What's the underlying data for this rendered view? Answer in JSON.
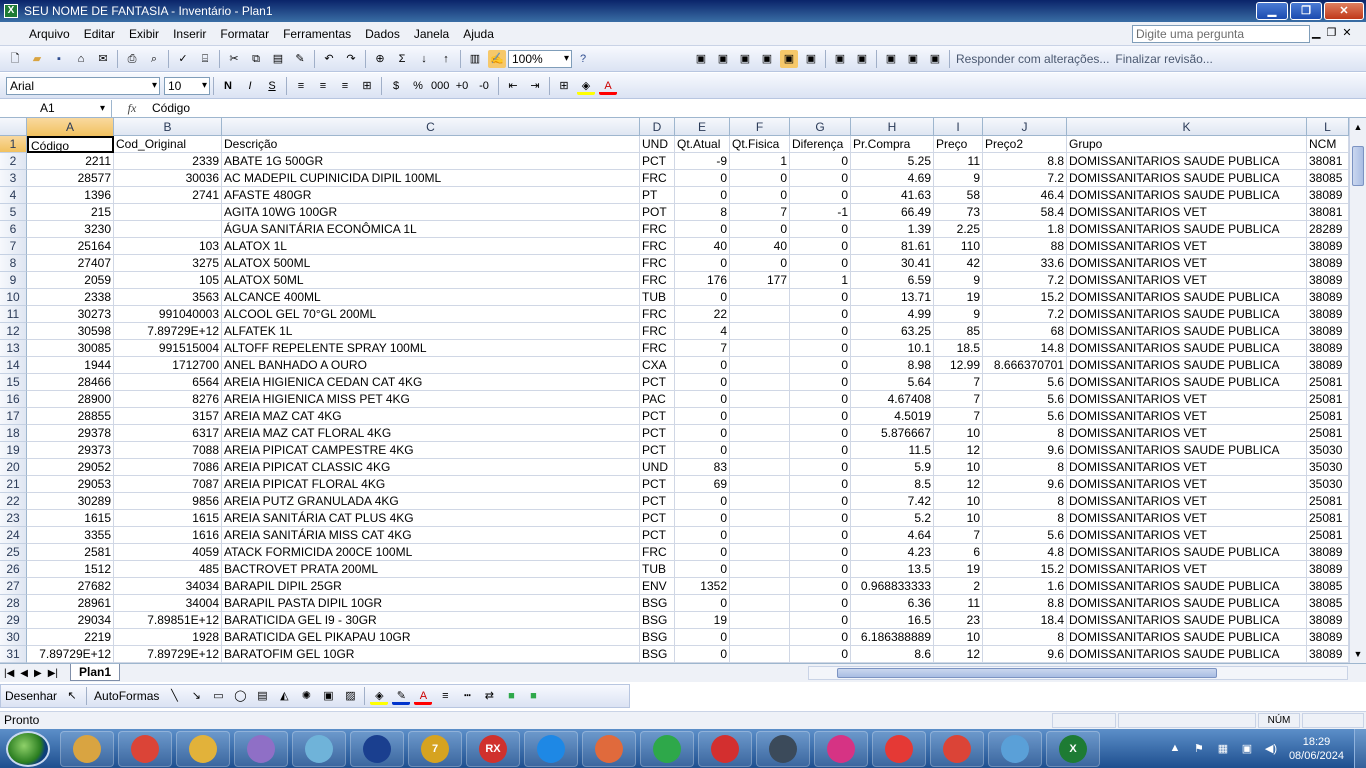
{
  "window": {
    "title": "SEU NOME DE FANTASIA - Inventário - Plan1",
    "app_icon": "excel-icon"
  },
  "menu": [
    "Arquivo",
    "Editar",
    "Exibir",
    "Inserir",
    "Formatar",
    "Ferramentas",
    "Dados",
    "Janela",
    "Ajuda"
  ],
  "ask": {
    "placeholder": "Digite uma pergunta"
  },
  "toolbar": {
    "zoom": "100%",
    "review_reply": "Responder com alterações...",
    "review_finish": "Finalizar revisão..."
  },
  "format": {
    "font": "Arial",
    "size": "10"
  },
  "formula": {
    "cell": "A1",
    "fx": "fx",
    "content": "Código"
  },
  "columns": [
    {
      "letter": "A",
      "width": 87
    },
    {
      "letter": "B",
      "width": 108
    },
    {
      "letter": "C",
      "width": 418
    },
    {
      "letter": "D",
      "width": 35
    },
    {
      "letter": "E",
      "width": 55
    },
    {
      "letter": "F",
      "width": 60
    },
    {
      "letter": "G",
      "width": 61
    },
    {
      "letter": "H",
      "width": 83
    },
    {
      "letter": "I",
      "width": 49
    },
    {
      "letter": "J",
      "width": 84
    },
    {
      "letter": "K",
      "width": 240
    },
    {
      "letter": "L",
      "width": 42
    }
  ],
  "header": [
    "Código",
    "Cod_Original",
    "Descrição",
    "UND",
    "Qt.Atual",
    "Qt.Fisica",
    "Diferença",
    "Pr.Compra",
    "Preço",
    "Preço2",
    "Grupo",
    "NCM"
  ],
  "rows": [
    [
      "2211",
      "2339",
      "ABATE 1G 500GR",
      "PCT",
      "-9",
      "1",
      "0",
      "5.25",
      "11",
      "8.8",
      "DOMISSANITARIOS SAUDE PUBLICA",
      "38081"
    ],
    [
      "28577",
      "30036",
      "AC MADEPIL CUPINICIDA DIPIL 100ML",
      "FRC",
      "0",
      "0",
      "0",
      "4.69",
      "9",
      "7.2",
      "DOMISSANITARIOS SAUDE PUBLICA",
      "38085"
    ],
    [
      "1396",
      "2741",
      "AFASTE 480GR",
      "PT",
      "0",
      "0",
      "0",
      "41.63",
      "58",
      "46.4",
      "DOMISSANITARIOS SAUDE PUBLICA",
      "38089"
    ],
    [
      "215",
      "",
      "AGITA 10WG 100GR",
      "POT",
      "8",
      "7",
      "-1",
      "66.49",
      "73",
      "58.4",
      "DOMISSANITARIOS VET",
      "38081"
    ],
    [
      "3230",
      "",
      "ÁGUA SANITÁRIA ECONÔMICA 1L",
      "FRC",
      "0",
      "0",
      "0",
      "1.39",
      "2.25",
      "1.8",
      "DOMISSANITARIOS SAUDE PUBLICA",
      "28289"
    ],
    [
      "25164",
      "103",
      "ALATOX 1L",
      "FRC",
      "40",
      "40",
      "0",
      "81.61",
      "110",
      "88",
      "DOMISSANITARIOS VET",
      "38089"
    ],
    [
      "27407",
      "3275",
      "ALATOX 500ML",
      "FRC",
      "0",
      "0",
      "0",
      "30.41",
      "42",
      "33.6",
      "DOMISSANITARIOS VET",
      "38089"
    ],
    [
      "2059",
      "105",
      "ALATOX 50ML",
      "FRC",
      "176",
      "177",
      "1",
      "6.59",
      "9",
      "7.2",
      "DOMISSANITARIOS VET",
      "38089"
    ],
    [
      "2338",
      "3563",
      "ALCANCE 400ML",
      "TUB",
      "0",
      "",
      "0",
      "13.71",
      "19",
      "15.2",
      "DOMISSANITARIOS SAUDE PUBLICA",
      "38089"
    ],
    [
      "30273",
      "991040003",
      "ALCOOL GEL 70°GL 200ML",
      "FRC",
      "22",
      "",
      "0",
      "4.99",
      "9",
      "7.2",
      "DOMISSANITARIOS SAUDE PUBLICA",
      "38089"
    ],
    [
      "30598",
      "7.89729E+12",
      "ALFATEK 1L",
      "FRC",
      "4",
      "",
      "0",
      "63.25",
      "85",
      "68",
      "DOMISSANITARIOS SAUDE PUBLICA",
      "38089"
    ],
    [
      "30085",
      "991515004",
      "ALTOFF REPELENTE SPRAY 100ML",
      "FRC",
      "7",
      "",
      "0",
      "10.1",
      "18.5",
      "14.8",
      "DOMISSANITARIOS SAUDE PUBLICA",
      "38089"
    ],
    [
      "1944",
      "1712700",
      "ANEL BANHADO A OURO",
      "CXA",
      "0",
      "",
      "0",
      "8.98",
      "12.99",
      "8.666370701",
      "DOMISSANITARIOS SAUDE PUBLICA",
      "38089"
    ],
    [
      "28466",
      "6564",
      "AREIA HIGIENICA CEDAN CAT 4KG",
      "PCT",
      "0",
      "",
      "0",
      "5.64",
      "7",
      "5.6",
      "DOMISSANITARIOS SAUDE PUBLICA",
      "25081"
    ],
    [
      "28900",
      "8276",
      "AREIA HIGIENICA MISS PET 4KG",
      "PAC",
      "0",
      "",
      "0",
      "4.67408",
      "7",
      "5.6",
      "DOMISSANITARIOS VET",
      "25081"
    ],
    [
      "28855",
      "3157",
      "AREIA MAZ CAT 4KG",
      "PCT",
      "0",
      "",
      "0",
      "4.5019",
      "7",
      "5.6",
      "DOMISSANITARIOS VET",
      "25081"
    ],
    [
      "29378",
      "6317",
      "AREIA MAZ CAT FLORAL 4KG",
      "PCT",
      "0",
      "",
      "0",
      "5.876667",
      "10",
      "8",
      "DOMISSANITARIOS VET",
      "25081"
    ],
    [
      "29373",
      "7088",
      "AREIA PIPICAT CAMPESTRE 4KG",
      "PCT",
      "0",
      "",
      "0",
      "11.5",
      "12",
      "9.6",
      "DOMISSANITARIOS SAUDE PUBLICA",
      "35030"
    ],
    [
      "29052",
      "7086",
      "AREIA PIPICAT CLASSIC 4KG",
      "UND",
      "83",
      "",
      "0",
      "5.9",
      "10",
      "8",
      "DOMISSANITARIOS VET",
      "35030"
    ],
    [
      "29053",
      "7087",
      "AREIA PIPICAT FLORAL 4KG",
      "PCT",
      "69",
      "",
      "0",
      "8.5",
      "12",
      "9.6",
      "DOMISSANITARIOS VET",
      "35030"
    ],
    [
      "30289",
      "9856",
      "AREIA PUTZ GRANULADA 4KG",
      "PCT",
      "0",
      "",
      "0",
      "7.42",
      "10",
      "8",
      "DOMISSANITARIOS VET",
      "25081"
    ],
    [
      "1615",
      "1615",
      "AREIA SANITÁRIA CAT PLUS 4KG",
      "PCT",
      "0",
      "",
      "0",
      "5.2",
      "10",
      "8",
      "DOMISSANITARIOS VET",
      "25081"
    ],
    [
      "3355",
      "1616",
      "AREIA SANITÁRIA MISS CAT 4KG",
      "PCT",
      "0",
      "",
      "0",
      "4.64",
      "7",
      "5.6",
      "DOMISSANITARIOS VET",
      "25081"
    ],
    [
      "2581",
      "4059",
      "ATACK FORMICIDA 200CE 100ML",
      "FRC",
      "0",
      "",
      "0",
      "4.23",
      "6",
      "4.8",
      "DOMISSANITARIOS SAUDE PUBLICA",
      "38089"
    ],
    [
      "1512",
      "485",
      "BACTROVET PRATA 200ML",
      "TUB",
      "0",
      "",
      "0",
      "13.5",
      "19",
      "15.2",
      "DOMISSANITARIOS VET",
      "38089"
    ],
    [
      "27682",
      "34034",
      "BARAPIL DIPIL 25GR",
      "ENV",
      "1352",
      "",
      "0",
      "0.968833333",
      "2",
      "1.6",
      "DOMISSANITARIOS SAUDE PUBLICA",
      "38085"
    ],
    [
      "28961",
      "34004",
      "BARAPIL PASTA DIPIL 10GR",
      "BSG",
      "0",
      "",
      "0",
      "6.36",
      "11",
      "8.8",
      "DOMISSANITARIOS SAUDE PUBLICA",
      "38085"
    ],
    [
      "29034",
      "7.89851E+12",
      "BARATICIDA GEL I9 - 30GR",
      "BSG",
      "19",
      "",
      "0",
      "16.5",
      "23",
      "18.4",
      "DOMISSANITARIOS SAUDE PUBLICA",
      "38089"
    ],
    [
      "2219",
      "1928",
      "BARATICIDA GEL PIKAPAU 10GR",
      "BSG",
      "0",
      "",
      "0",
      "6.186388889",
      "10",
      "8",
      "DOMISSANITARIOS SAUDE PUBLICA",
      "38089"
    ],
    [
      "7.89729E+12",
      "7.89729E+12",
      "BARATOFIM GEL 10GR",
      "BSG",
      "0",
      "",
      "0",
      "8.6",
      "12",
      "9.6",
      "DOMISSANITARIOS SAUDE PUBLICA",
      "38089"
    ]
  ],
  "sheet": {
    "tab": "Plan1"
  },
  "draw": {
    "desenhar": "Desenhar",
    "autoformas": "AutoFormas"
  },
  "status": {
    "left": "Pronto",
    "num": "NÚM"
  },
  "taskbar": {
    "apps": [
      {
        "name": "explorer",
        "color": "#d9a441",
        "glyph": ""
      },
      {
        "name": "chrome",
        "color": "#db4437",
        "glyph": ""
      },
      {
        "name": "app-yellow",
        "color": "#e2b23a",
        "glyph": ""
      },
      {
        "name": "paint",
        "color": "#8f6fc6",
        "glyph": ""
      },
      {
        "name": "app-map",
        "color": "#6fb3d9",
        "glyph": ""
      },
      {
        "name": "app-blue",
        "color": "#1a3f8f",
        "glyph": ""
      },
      {
        "name": "app-seven",
        "color": "#d6a320",
        "glyph": "7"
      },
      {
        "name": "app-rx",
        "color": "#d0312d",
        "glyph": "RX"
      },
      {
        "name": "app-p-blue",
        "color": "#1e88e5",
        "glyph": ""
      },
      {
        "name": "app-p-orange",
        "color": "#e06a3c",
        "glyph": ""
      },
      {
        "name": "app-p-green",
        "color": "#2ea84a",
        "glyph": ""
      },
      {
        "name": "app-p-red",
        "color": "#d32f2f",
        "glyph": ""
      },
      {
        "name": "app-p-dark",
        "color": "#3b4a5a",
        "glyph": ""
      },
      {
        "name": "app-p-pink",
        "color": "#d63384",
        "glyph": ""
      },
      {
        "name": "anydesk",
        "color": "#e53935",
        "glyph": ""
      },
      {
        "name": "chrome-user",
        "color": "#db4437",
        "glyph": ""
      },
      {
        "name": "app-paint2",
        "color": "#5aa0d8",
        "glyph": ""
      },
      {
        "name": "excel",
        "color": "#1e7b34",
        "glyph": "X"
      }
    ],
    "time": "18:29",
    "date": "08/06/2024"
  }
}
